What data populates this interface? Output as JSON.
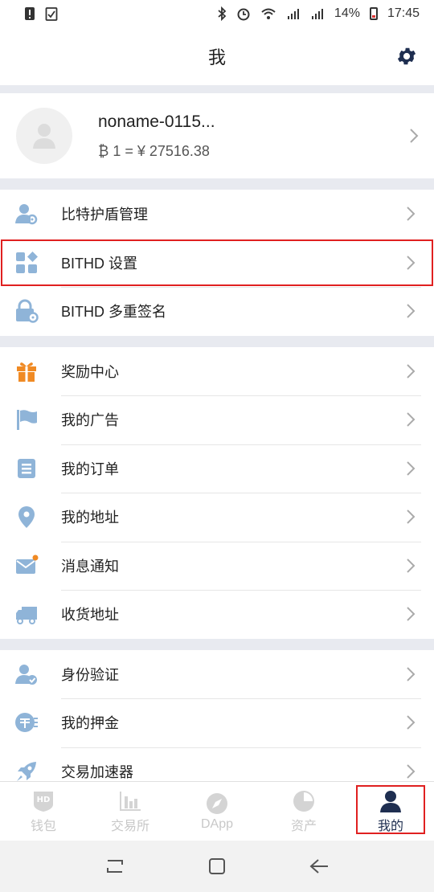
{
  "status_bar": {
    "battery": "14%",
    "time": "17:45"
  },
  "header": {
    "title": "我"
  },
  "profile": {
    "name": "noname-0115...",
    "rate": "₿ 1 = ¥ 27516.38"
  },
  "groups": [
    [
      {
        "label": "比特护盾管理",
        "icon": "user-gear-icon"
      },
      {
        "label": "BITHD 设置",
        "icon": "grid-settings-icon"
      },
      {
        "label": "BITHD 多重签名",
        "icon": "lock-gear-icon"
      }
    ],
    [
      {
        "label": "奖励中心",
        "icon": "gift-icon"
      },
      {
        "label": "我的广告",
        "icon": "flag-icon"
      },
      {
        "label": "我的订单",
        "icon": "order-list-icon"
      },
      {
        "label": "我的地址",
        "icon": "location-pin-icon"
      },
      {
        "label": "消息通知",
        "icon": "mail-icon"
      },
      {
        "label": "收货地址",
        "icon": "truck-icon"
      }
    ],
    [
      {
        "label": "身份验证",
        "icon": "user-verified-icon"
      },
      {
        "label": "我的押金",
        "icon": "deposit-icon"
      },
      {
        "label": "交易加速器",
        "icon": "rocket-icon"
      }
    ]
  ],
  "tabs": [
    {
      "label": "钱包",
      "icon": "hd-wallet-icon"
    },
    {
      "label": "交易所",
      "icon": "exchange-chart-icon"
    },
    {
      "label": "DApp",
      "icon": "compass-icon"
    },
    {
      "label": "资产",
      "icon": "pie-chart-icon"
    },
    {
      "label": "我的",
      "icon": "person-icon"
    }
  ],
  "colors": {
    "icon_blue": "#8fb4d8",
    "accent_orange": "#f08a24",
    "active_tab": "#1e2e50",
    "highlight_red": "#e02020"
  }
}
